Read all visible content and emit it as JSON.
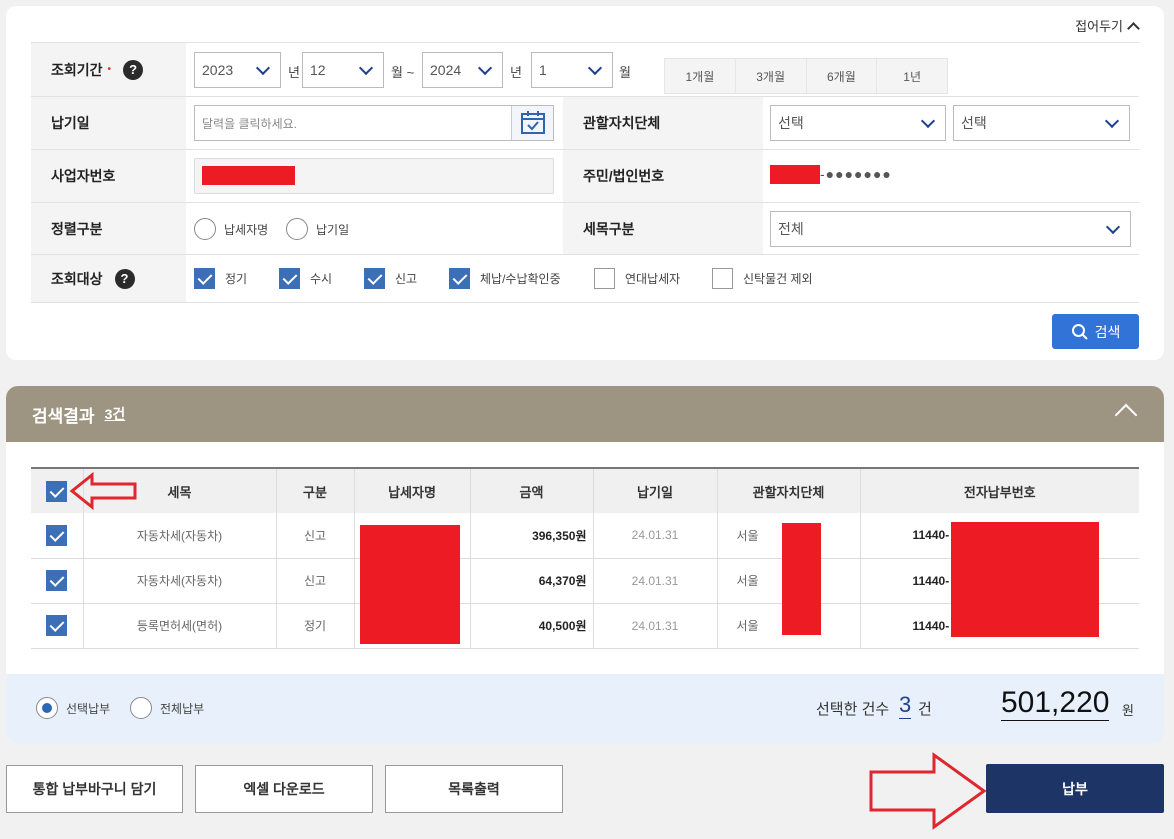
{
  "search": {
    "collapse_label": "접어두기",
    "period": {
      "label": "조회기간",
      "required_mark": "•",
      "from_year": "2023",
      "year_unit": "년",
      "from_month": "12",
      "month_unit_tilde": "월 ~",
      "to_year": "2024",
      "year_unit2": "년",
      "to_month": "1",
      "month_unit": "월",
      "quick": [
        "1개월",
        "3개월",
        "6개월",
        "1년"
      ]
    },
    "due_date": {
      "label": "납기일",
      "placeholder": "달력을 클릭하세요."
    },
    "local_gov": {
      "label": "관할자치단체",
      "select1": "선택",
      "select2": "선택"
    },
    "biz_no": {
      "label": "사업자번호"
    },
    "resident_no": {
      "label": "주민/법인번호",
      "masked": "-●●●●●●●"
    },
    "sort": {
      "label": "정렬구분",
      "options": [
        "납세자명",
        "납기일"
      ]
    },
    "tax_type": {
      "label": "세목구분",
      "value": "전체"
    },
    "target": {
      "label": "조회대상",
      "options": [
        {
          "label": "정기",
          "checked": true
        },
        {
          "label": "수시",
          "checked": true
        },
        {
          "label": "신고",
          "checked": true
        },
        {
          "label": "체납/수납확인중",
          "checked": true
        },
        {
          "label": "연대납세자",
          "checked": false
        },
        {
          "label": "신탁물건 제외",
          "checked": false
        }
      ]
    },
    "search_button": "검색"
  },
  "results": {
    "title": "검색결과",
    "count": "3건",
    "columns": [
      "세목",
      "구분",
      "납세자명",
      "금액",
      "납기일",
      "관할자치단체",
      "전자납부번호"
    ],
    "rows": [
      {
        "tax": "자동차세(자동차)",
        "type": "신고",
        "amount": "396,350원",
        "due": "24.01.31",
        "gov": "서울",
        "pay_no": "11440-"
      },
      {
        "tax": "자동차세(자동차)",
        "type": "신고",
        "amount": "64,370원",
        "due": "24.01.31",
        "gov": "서울",
        "pay_no": "11440-"
      },
      {
        "tax": "등록면허세(면허)",
        "type": "정기",
        "amount": "40,500원",
        "due": "24.01.31",
        "gov": "서울",
        "pay_no": "11440-"
      }
    ],
    "pay_mode": [
      "선택납부",
      "전체납부"
    ],
    "selected_count_label": "선택한 건수",
    "selected_count": "3",
    "count_unit": "건",
    "total": "501,220",
    "won": "원"
  },
  "actions": {
    "cart": "통합 납부바구니 담기",
    "excel": "엑셀 다운로드",
    "print": "목록출력",
    "pay": "납부"
  },
  "colors": {
    "header_bar": "#9e9482",
    "pay_button": "#1d3566",
    "search_button": "#3273d8",
    "checkbox": "#3d6fb6"
  }
}
